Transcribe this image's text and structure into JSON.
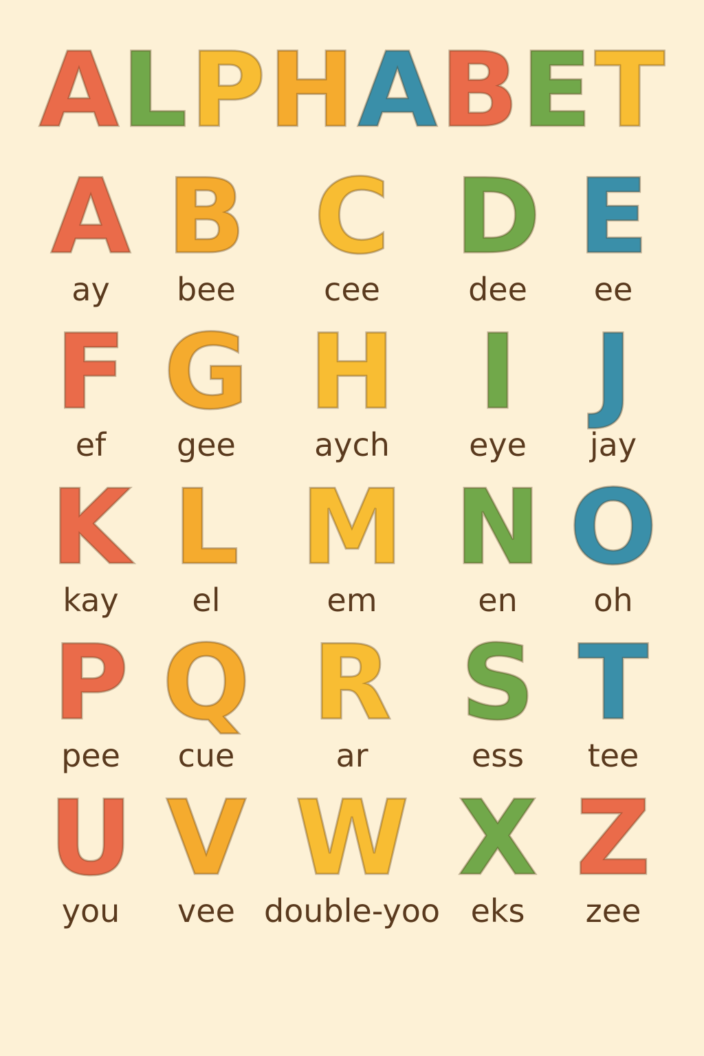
{
  "colors": {
    "background": "#fdf1d6",
    "red": "#ea6b4a",
    "orange": "#f5ab2e",
    "yellow": "#f8bd33",
    "green": "#71a84a",
    "blue": "#3a8fa9",
    "text": "#5a3a1e"
  },
  "title": [
    {
      "char": "A",
      "color": "#ea6b4a"
    },
    {
      "char": "L",
      "color": "#71a84a"
    },
    {
      "char": "P",
      "color": "#f8bd33"
    },
    {
      "char": "H",
      "color": "#f5ab2e"
    },
    {
      "char": "A",
      "color": "#3a8fa9"
    },
    {
      "char": "B",
      "color": "#ea6b4a"
    },
    {
      "char": "E",
      "color": "#71a84a"
    },
    {
      "char": "T",
      "color": "#f8bd33"
    }
  ],
  "letters": [
    {
      "char": "A",
      "word": "ay",
      "color": "#ea6b4a"
    },
    {
      "char": "B",
      "word": "bee",
      "color": "#f5ab2e"
    },
    {
      "char": "C",
      "word": "cee",
      "color": "#f8bd33"
    },
    {
      "char": "D",
      "word": "dee",
      "color": "#71a84a"
    },
    {
      "char": "E",
      "word": "ee",
      "color": "#3a8fa9"
    },
    {
      "char": "F",
      "word": "ef",
      "color": "#ea6b4a"
    },
    {
      "char": "G",
      "word": "gee",
      "color": "#f5ab2e"
    },
    {
      "char": "H",
      "word": "aych",
      "color": "#f8bd33"
    },
    {
      "char": "I",
      "word": "eye",
      "color": "#71a84a"
    },
    {
      "char": "J",
      "word": "jay",
      "color": "#3a8fa9"
    },
    {
      "char": "K",
      "word": "kay",
      "color": "#ea6b4a"
    },
    {
      "char": "L",
      "word": "el",
      "color": "#f5ab2e"
    },
    {
      "char": "M",
      "word": "em",
      "color": "#f8bd33"
    },
    {
      "char": "N",
      "word": "en",
      "color": "#71a84a"
    },
    {
      "char": "O",
      "word": "oh",
      "color": "#3a8fa9"
    },
    {
      "char": "P",
      "word": "pee",
      "color": "#ea6b4a"
    },
    {
      "char": "Q",
      "word": "cue",
      "color": "#f5ab2e"
    },
    {
      "char": "R",
      "word": "ar",
      "color": "#f8bd33"
    },
    {
      "char": "S",
      "word": "ess",
      "color": "#71a84a"
    },
    {
      "char": "T",
      "word": "tee",
      "color": "#3a8fa9"
    },
    {
      "char": "U",
      "word": "you",
      "color": "#ea6b4a"
    },
    {
      "char": "V",
      "word": "vee",
      "color": "#f5ab2e"
    },
    {
      "char": "W",
      "word": "double-yoo",
      "color": "#f8bd33"
    },
    {
      "char": "X",
      "word": "eks",
      "color": "#71a84a"
    },
    {
      "char": "Z",
      "word": "zee",
      "color": "#ea6b4a"
    }
  ]
}
